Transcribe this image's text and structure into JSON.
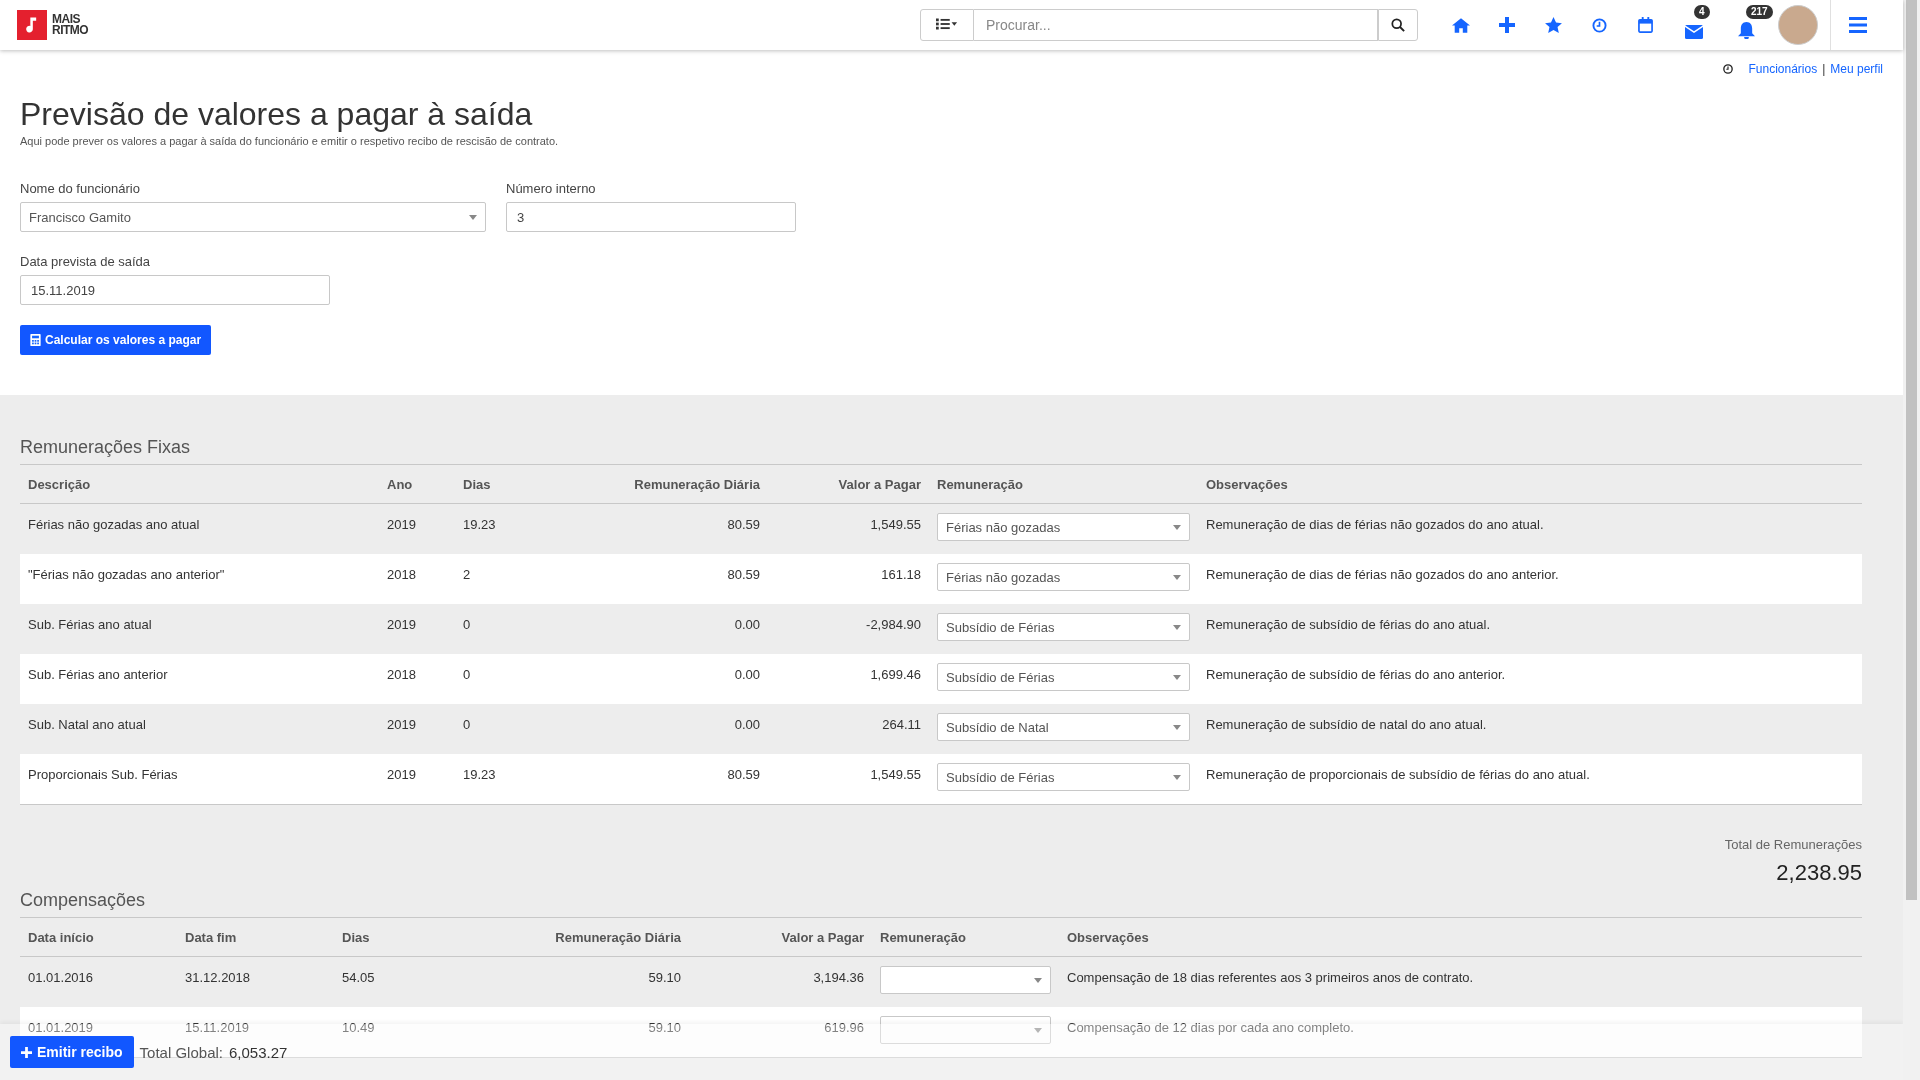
{
  "logo": {
    "lines": [
      "MAIS",
      "RITMO"
    ]
  },
  "top_bar": {
    "search": {
      "placeholder": "Procurar..."
    },
    "message_count": "4",
    "notification_count": "217"
  },
  "breadcrumb": {
    "links": [
      "Funcionários",
      "Meu perfil"
    ],
    "separator": "|"
  },
  "page": {
    "title": "Previsão de valores a pagar à saída",
    "subtitle": "Aqui pode prever os valores a pagar à saída do funcionário e emitir o respetivo recibo de rescisão de contrato."
  },
  "form": {
    "fields": [
      {
        "label": "Nome do funcionário",
        "value": "Francisco Gamito",
        "kind": "select"
      },
      {
        "label": "Número interno",
        "value": "3",
        "kind": "text"
      },
      {
        "label": "Data prevista de saída",
        "value": "15.11.2019",
        "kind": "text"
      }
    ],
    "button": "Calcular os valores a pagar"
  },
  "fixed_remunerations": {
    "heading": "Remunerações Fixas",
    "columns": [
      "Descrição",
      "Ano",
      "Dias",
      "Remuneração Diária",
      "Valor a Pagar",
      "Remuneração",
      "Observações"
    ],
    "rows": [
      {
        "cells": [
          "Férias não gozadas ano atual",
          "2019",
          "19.23",
          "80.59",
          "1,549.55"
        ],
        "remuneration": "Férias não gozadas",
        "notes": "Remuneração de dias de férias não gozados do ano atual."
      },
      {
        "cells": [
          "\"Férias não gozadas ano anterior\"",
          "2018",
          "2",
          "80.59",
          "161.18"
        ],
        "remuneration": "Férias não gozadas",
        "notes": "Remuneração de dias de férias não gozados do ano anterior."
      },
      {
        "cells": [
          "Sub. Férias ano atual",
          "2019",
          "0",
          "0.00",
          "-2,984.90"
        ],
        "remuneration": "Subsídio de Férias",
        "notes": "Remuneração de subsídio de férias do ano atual."
      },
      {
        "cells": [
          "Sub. Férias ano anterior",
          "2018",
          "0",
          "0.00",
          "1,699.46"
        ],
        "remuneration": "Subsídio de Férias",
        "notes": "Remuneração de subsídio de férias do ano anterior."
      },
      {
        "cells": [
          "Sub. Natal ano atual",
          "2019",
          "0",
          "0.00",
          "264.11"
        ],
        "remuneration": "Subsídio de Natal",
        "notes": "Remuneração de subsídio de natal do ano atual."
      },
      {
        "cells": [
          "Proporcionais Sub. Férias",
          "2019",
          "19.23",
          "80.59",
          "1,549.55"
        ],
        "remuneration": "Subsídio de Férias",
        "notes": "Remuneração de proporcionais de subsídio de férias do ano atual."
      }
    ],
    "total_label": "Total de Remunerações",
    "total_value": "2,238.95"
  },
  "compensations": {
    "heading": "Compensações",
    "columns": [
      "Data início",
      "Data fim",
      "Dias",
      "Remuneração Diária",
      "Valor a Pagar",
      "Remuneração",
      "Observações"
    ],
    "rows": [
      {
        "cells": [
          "01.01.2016",
          "31.12.2018",
          "54.05",
          "59.10",
          "3,194.36"
        ],
        "notes": "Compensação de 18 dias referentes aos 3 primeiros anos de contrato."
      },
      {
        "cells": [
          "01.01.2019",
          "15.11.2019",
          "10.49",
          "59.10",
          "619.96"
        ],
        "notes": "Compensação de 12 dias por cada ano completo."
      }
    ]
  },
  "footer": {
    "button": "Emitir recibo",
    "total_label": "Total Global:",
    "total_value": "6,053.27"
  }
}
